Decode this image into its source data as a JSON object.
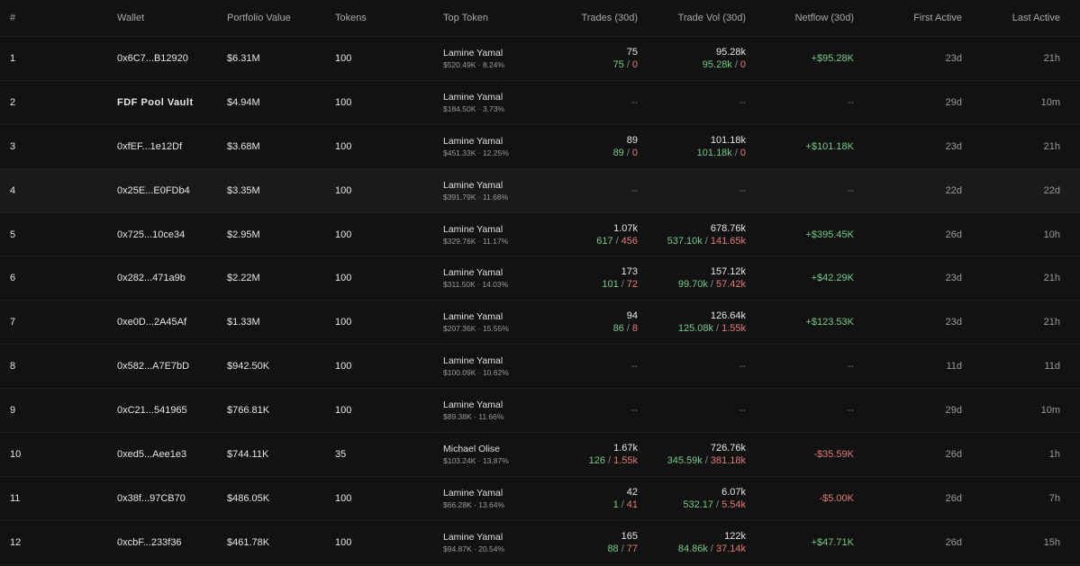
{
  "header": {
    "rank": "#",
    "wallet": "Wallet",
    "portfolio_value": "Portfolio Value",
    "tokens": "Tokens",
    "top_token": "Top Token",
    "trades": "Trades (30d)",
    "trade_vol": "Trade Vol (30d)",
    "netflow": "Netflow (30d)",
    "first_active": "First Active",
    "last_active": "Last Active"
  },
  "rows": [
    {
      "rank": "1",
      "wallet": "0x6C7...B12920",
      "pv": "$6.31M",
      "tokens": "100",
      "top_name": "Lamine Yamal",
      "top_sub": "$520.49K · 8.24%",
      "trades": "75",
      "trades_buy": "75",
      "trades_sell": "0",
      "vol": "95.28k",
      "vol_buy": "95.28k",
      "vol_sell": "0",
      "net": "+$95.28K",
      "net_sign": "pos",
      "first": "23d",
      "last": "21h"
    },
    {
      "rank": "2",
      "wallet": "FDF Pool Vault",
      "wallet_bold": true,
      "pv": "$4.94M",
      "tokens": "100",
      "top_name": "Lamine Yamal",
      "top_sub": "$184.50K · 3.73%",
      "trades": "--",
      "vol": "--",
      "net": "--",
      "net_sign": "none",
      "first": "29d",
      "last": "10m"
    },
    {
      "rank": "3",
      "wallet": "0xfEF...1e12Df",
      "pv": "$3.68M",
      "tokens": "100",
      "top_name": "Lamine Yamal",
      "top_sub": "$451.33K · 12.25%",
      "trades": "89",
      "trades_buy": "89",
      "trades_sell": "0",
      "vol": "101.18k",
      "vol_buy": "101.18k",
      "vol_sell": "0",
      "net": "+$101.18K",
      "net_sign": "pos",
      "first": "23d",
      "last": "21h"
    },
    {
      "rank": "4",
      "wallet": "0x25E...E0FDb4",
      "pv": "$3.35M",
      "tokens": "100",
      "top_name": "Lamine Yamal",
      "top_sub": "$391.79K · 11.68%",
      "trades": "--",
      "vol": "--",
      "net": "--",
      "net_sign": "none",
      "first": "22d",
      "last": "22d",
      "highlight": true
    },
    {
      "rank": "5",
      "wallet": "0x725...10ce34",
      "pv": "$2.95M",
      "tokens": "100",
      "top_name": "Lamine Yamal",
      "top_sub": "$329.76K · 11.17%",
      "trades": "1.07k",
      "trades_buy": "617",
      "trades_sell": "456",
      "vol": "678.76k",
      "vol_buy": "537.10k",
      "vol_sell": "141.65k",
      "net": "+$395.45K",
      "net_sign": "pos",
      "first": "26d",
      "last": "10h"
    },
    {
      "rank": "6",
      "wallet": "0x282...471a9b",
      "pv": "$2.22M",
      "tokens": "100",
      "top_name": "Lamine Yamal",
      "top_sub": "$311.50K · 14.03%",
      "trades": "173",
      "trades_buy": "101",
      "trades_sell": "72",
      "vol": "157.12k",
      "vol_buy": "99.70k",
      "vol_sell": "57.42k",
      "net": "+$42.29K",
      "net_sign": "pos",
      "first": "23d",
      "last": "21h"
    },
    {
      "rank": "7",
      "wallet": "0xe0D...2A45Af",
      "pv": "$1.33M",
      "tokens": "100",
      "top_name": "Lamine Yamal",
      "top_sub": "$207.36K · 15.55%",
      "trades": "94",
      "trades_buy": "86",
      "trades_sell": "8",
      "vol": "126.64k",
      "vol_buy": "125.08k",
      "vol_sell": "1.55k",
      "net": "+$123.53K",
      "net_sign": "pos",
      "first": "23d",
      "last": "21h"
    },
    {
      "rank": "8",
      "wallet": "0x582...A7E7bD",
      "pv": "$942.50K",
      "tokens": "100",
      "top_name": "Lamine Yamal",
      "top_sub": "$100.09K · 10.62%",
      "trades": "--",
      "vol": "--",
      "net": "--",
      "net_sign": "none",
      "first": "11d",
      "last": "11d"
    },
    {
      "rank": "9",
      "wallet": "0xC21...541965",
      "pv": "$766.81K",
      "tokens": "100",
      "top_name": "Lamine Yamal",
      "top_sub": "$89.38K · 11.66%",
      "trades": "--",
      "vol": "--",
      "net": "--",
      "net_sign": "none",
      "first": "29d",
      "last": "10m"
    },
    {
      "rank": "10",
      "wallet": "0xed5...Aee1e3",
      "pv": "$744.11K",
      "tokens": "35",
      "top_name": "Michael Olise",
      "top_sub": "$103.24K · 13.87%",
      "trades": "1.67k",
      "trades_buy": "126",
      "trades_sell": "1.55k",
      "vol": "726.76k",
      "vol_buy": "345.59k",
      "vol_sell": "381.18k",
      "net": "-$35.59K",
      "net_sign": "neg",
      "first": "26d",
      "last": "1h"
    },
    {
      "rank": "11",
      "wallet": "0x38f...97CB70",
      "pv": "$486.05K",
      "tokens": "100",
      "top_name": "Lamine Yamal",
      "top_sub": "$66.28K · 13.64%",
      "trades": "42",
      "trades_buy": "1",
      "trades_sell": "41",
      "vol": "6.07k",
      "vol_buy": "532.17",
      "vol_sell": "5.54k",
      "net": "-$5.00K",
      "net_sign": "neg",
      "first": "26d",
      "last": "7h"
    },
    {
      "rank": "12",
      "wallet": "0xcbF...233f36",
      "pv": "$461.78K",
      "tokens": "100",
      "top_name": "Lamine Yamal",
      "top_sub": "$94.87K · 20.54%",
      "trades": "165",
      "trades_buy": "88",
      "trades_sell": "77",
      "vol": "122k",
      "vol_buy": "84.86k",
      "vol_sell": "37.14k",
      "net": "+$47.71K",
      "net_sign": "pos",
      "first": "26d",
      "last": "15h"
    }
  ],
  "colors": {
    "background": "#121212",
    "row_highlight": "#1a1a1a",
    "positive": "#79c98a",
    "negative": "#e47a7a"
  }
}
